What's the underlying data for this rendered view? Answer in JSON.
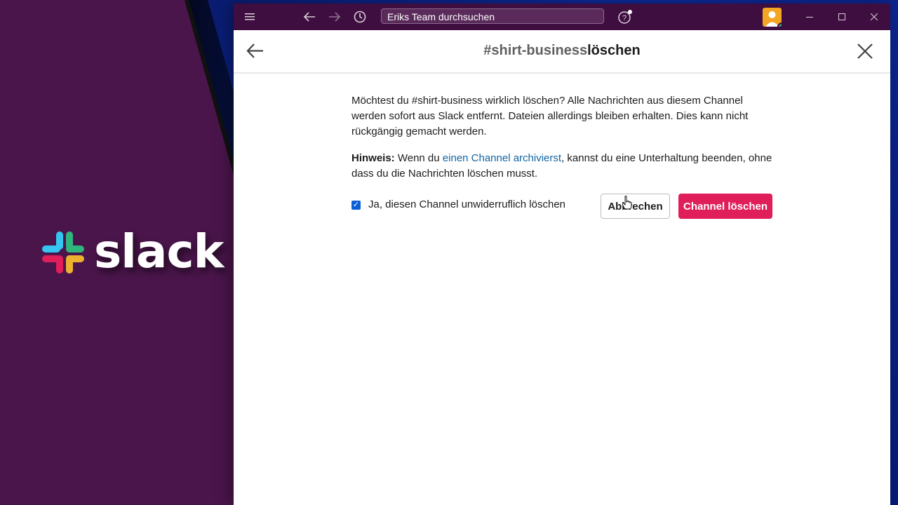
{
  "brand": {
    "logo_text": "slack"
  },
  "titlebar": {
    "menu_icon": "hamburger-icon",
    "back_icon": "arrow-left-icon",
    "forward_icon": "arrow-right-icon",
    "history_icon": "clock-icon",
    "search_placeholder": "Eriks Team durchsuchen",
    "help_icon": "help-icon"
  },
  "dialog": {
    "title_channel": "#shirt-business",
    "title_action": "löschen",
    "paragraph1": "Möchtest du #shirt-business wirklich löschen? Alle Nachrichten aus diesem Channel werden sofort aus Slack entfernt. Dateien allerdings bleiben erhalten. Dies kann nicht rückgängig gemacht werden.",
    "hint_label": "Hinweis:",
    "hint_before": " Wenn du ",
    "hint_link": "einen Channel archivierst",
    "hint_after": ", kannst du eine Unterhaltung beenden, ohne dass du die Nachrichten löschen musst.",
    "checkbox_label": "Ja, diesen Channel unwiderruflich löschen",
    "checkbox_checked": true,
    "cancel_label": "Abbrechen",
    "delete_label": "Channel löschen"
  },
  "colors": {
    "titlebar": "#3f0e40",
    "delete_button": "#e01e5a",
    "link": "#1264a3",
    "purple_bg": "#4a154b"
  }
}
